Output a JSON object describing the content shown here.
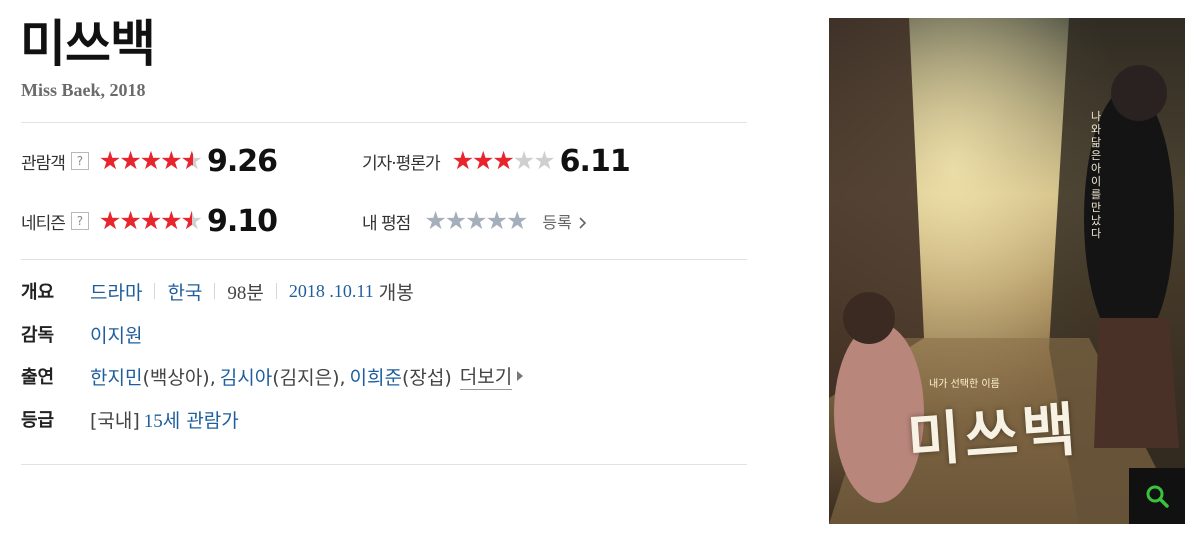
{
  "movie": {
    "title": "미쓰백",
    "subtitle": "Miss Baek, 2018"
  },
  "ratings": {
    "audience": {
      "label": "관람객",
      "help": "?",
      "score": "9.26",
      "stars": "★★★★★",
      "fill": 0.926
    },
    "critics": {
      "label": "기자·평론가",
      "score": "6.11",
      "stars": "★★★★★",
      "fill": 0.611
    },
    "netizen": {
      "label": "네티즌",
      "help": "?",
      "score": "9.10",
      "stars": "★★★★★",
      "fill": 0.91
    },
    "mine": {
      "label": "내 평점",
      "stars": "★★★★★",
      "action": "등록",
      "action_icon": "chevron-right-icon"
    }
  },
  "info": {
    "overview": {
      "label": "개요",
      "genre": "드라마",
      "country": "한국",
      "runtime_num": "98",
      "runtime_unit": "분",
      "release_date": "2018 .10.11",
      "release_suffix": "개봉"
    },
    "director": {
      "label": "감독",
      "name": "이지원"
    },
    "cast": {
      "label": "출연",
      "actors": [
        {
          "name": "한지민",
          "role": "(백상아),"
        },
        {
          "name": "김시아",
          "role": "(김지은),"
        },
        {
          "name": "이희준",
          "role": "(장섭)"
        }
      ],
      "more": "더보기",
      "more_icon": "triangle-right-icon"
    },
    "grade": {
      "label": "등급",
      "prefix": "[국내]",
      "age": "15",
      "value": "세 관람가"
    }
  },
  "poster": {
    "vertical_text": "나와 닮은 아이를 만났다",
    "tagline": "내가 선택한 이름",
    "logo": "미쓰백",
    "zoom_icon": "search-icon"
  },
  "colors": {
    "star_red": "#e8252d",
    "star_gray": "#cfcfcf",
    "star_blue_gray": "#a5afbb",
    "link_blue": "#1f5e9c"
  }
}
